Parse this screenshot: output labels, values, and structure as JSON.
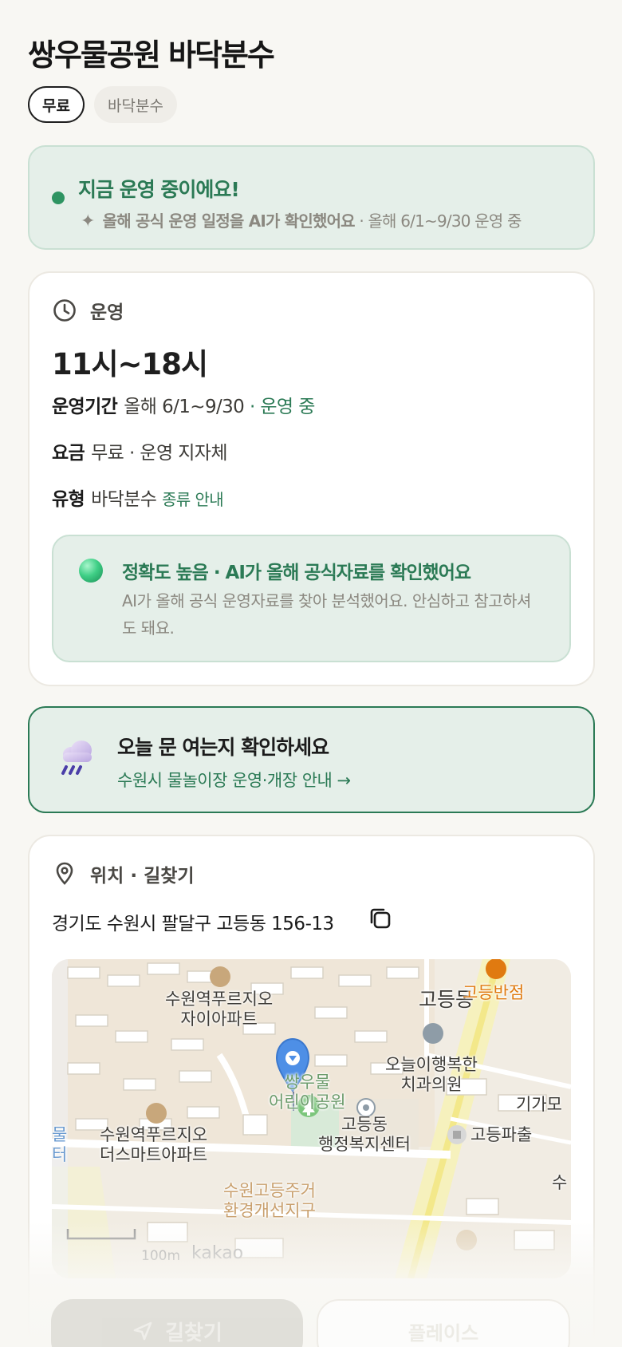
{
  "page": {
    "title": "쌍우물공원 바닥분수",
    "chips": {
      "free": "무료",
      "type": "바닥분수"
    }
  },
  "status": {
    "title": "지금 운영 중이에요!",
    "ai_note": "올해 공식 운영 일정을 AI가 확인했어요",
    "period_note": "· 올해 6/1~9/30 운영 중",
    "dot_color": "#2e9462"
  },
  "operation": {
    "section_label": "운영",
    "hours": "11시~18시",
    "period_key": "운영기간",
    "period_value": "올해 6/1~9/30",
    "period_status": "· 운영 중",
    "fee_key": "요금",
    "fee_value": "무료 · 운영 지자체",
    "type_key": "유형",
    "type_value": "바닥분수",
    "type_link": "종류 안내",
    "accuracy_title": "정확도 높음 · AI가 올해 공식자료를 확인했어요",
    "accuracy_desc": "AI가 올해 공식 운영자료를 찾아 분석했어요. 안심하고 참고하셔도 돼요."
  },
  "notice": {
    "title": "오늘 문 여는지 확인하세요",
    "link": "수원시 물놀이장 운영·개장 안내 →",
    "icon": "rain-cloud-icon"
  },
  "location": {
    "section_label": "위치 · 길찾기",
    "address": "경기도 수원시 팔달구 고등동 156-13",
    "map_labels": {
      "apt1": "수원역푸르지오\n자이아파트",
      "gdong": "고등동",
      "restaurant": "고등반점",
      "dental": "오늘이행복한\n치과의원",
      "park": "쌍우물\n어린이공원",
      "cut_left_1": "물",
      "cut_left_2": "터",
      "apt2": "수원역푸르지오\n더스마트아파트",
      "center": "고등동\n행정복지센터",
      "giga": "기가모",
      "police": "고등파출",
      "su": "수",
      "district": "수원고등주거\n환경개선지구"
    },
    "scale": "100m",
    "provider": "kakao"
  },
  "actions": {
    "directions": "길찾기",
    "place": "플레이스"
  },
  "colors": {
    "accent_green": "#2b7a55",
    "soft_green_bg": "#e5efe9",
    "page_bg": "#f8f7f3"
  }
}
